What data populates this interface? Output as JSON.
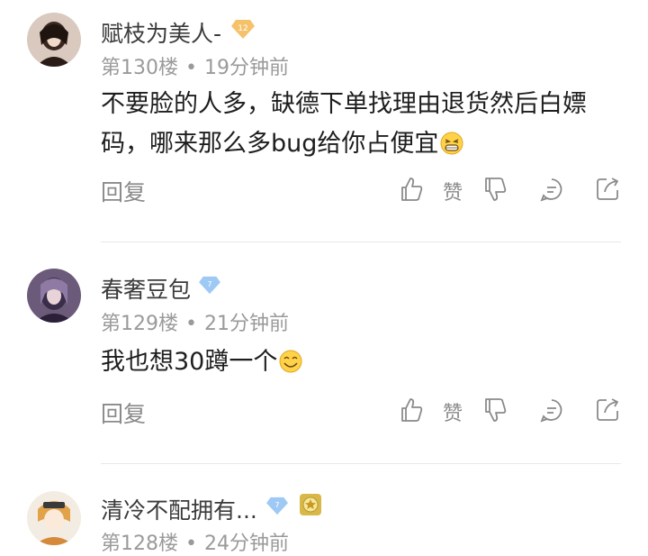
{
  "comments": [
    {
      "username": "赋枝为美人-",
      "badge_level": "12",
      "floor": "第130楼",
      "separator": "•",
      "time": "19分钟前",
      "text": "不要脸的人多，缺德下单找理由退货然后白嫖码，哪来那么多bug给你占便宜",
      "reply_label": "回复",
      "like_label": "赞"
    },
    {
      "username": "春奢豆包",
      "badge_level": "7",
      "floor": "第129楼",
      "separator": "•",
      "time": "21分钟前",
      "text": "我也想30蹲一个",
      "reply_label": "回复",
      "like_label": "赞"
    },
    {
      "username": "清冷不配拥有...",
      "badge_level": "7",
      "floor": "第128楼",
      "separator": "•",
      "time": "24分钟前"
    }
  ],
  "colors": {
    "badge_gold": "#f5c26b",
    "badge_blue": "#9ec9f5",
    "text_gray": "#9a9a9a"
  },
  "icons": [
    "thumbs-up-icon",
    "thumbs-down-icon",
    "comment-icon",
    "share-icon",
    "diamond-badge-icon",
    "emoji-icon"
  ]
}
